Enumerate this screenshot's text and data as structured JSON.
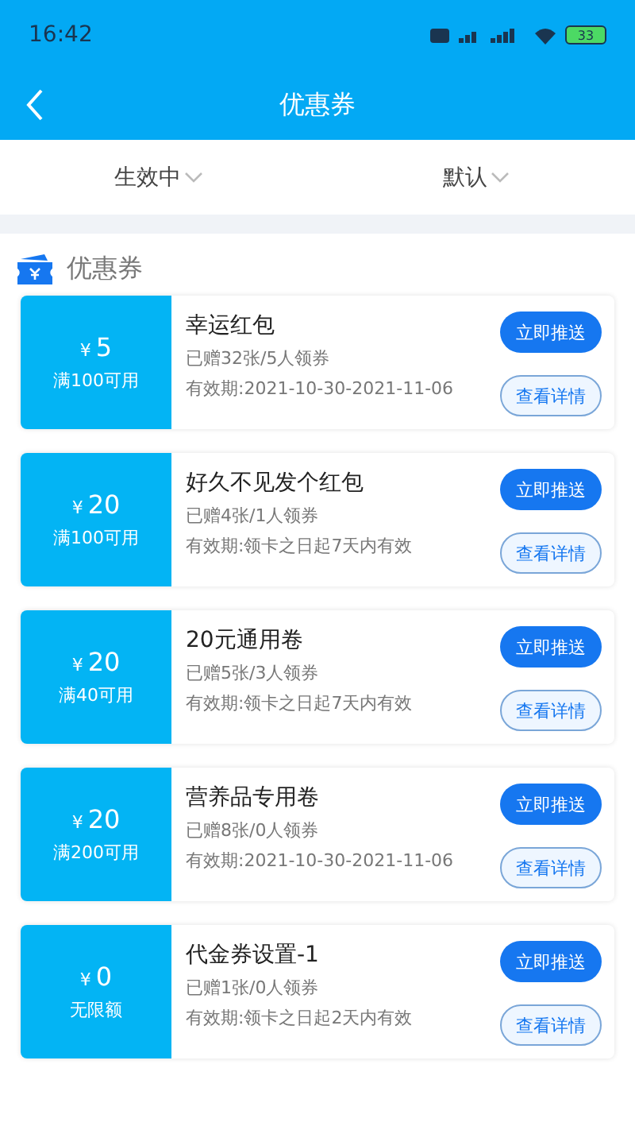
{
  "status_bar": {
    "time": "16:42",
    "battery": "33"
  },
  "header": {
    "title": "优惠券"
  },
  "filters": [
    {
      "label": "生效中"
    },
    {
      "label": "默认"
    }
  ],
  "section": {
    "title": "优惠券"
  },
  "coupons": [
    {
      "currency": "¥",
      "amount": "5",
      "condition": "满100可用",
      "name": "幸运红包",
      "stats": "已赠32张/5人领券",
      "validity": "有效期:2021-10-30-2021-11-06",
      "push": "立即推送",
      "details": "查看详情"
    },
    {
      "currency": "¥",
      "amount": "20",
      "condition": "满100可用",
      "name": "好久不见发个红包",
      "stats": "已赠4张/1人领券",
      "validity": "有效期:领卡之日起7天内有效",
      "push": "立即推送",
      "details": "查看详情"
    },
    {
      "currency": "¥",
      "amount": "20",
      "condition": "满40可用",
      "name": "20元通用卷",
      "stats": "已赠5张/3人领券",
      "validity": "有效期:领卡之日起7天内有效",
      "push": "立即推送",
      "details": "查看详情"
    },
    {
      "currency": "¥",
      "amount": "20",
      "condition": "满200可用",
      "name": "营养品专用卷",
      "stats": "已赠8张/0人领券",
      "validity": "有效期:2021-10-30-2021-11-06",
      "push": "立即推送",
      "details": "查看详情"
    },
    {
      "currency": "¥",
      "amount": "0",
      "condition": "无限额",
      "name": "代金券设置-1",
      "stats": "已赠1张/0人领券",
      "validity": "有效期:领卡之日起2天内有效",
      "push": "立即推送",
      "details": "查看详情"
    }
  ]
}
